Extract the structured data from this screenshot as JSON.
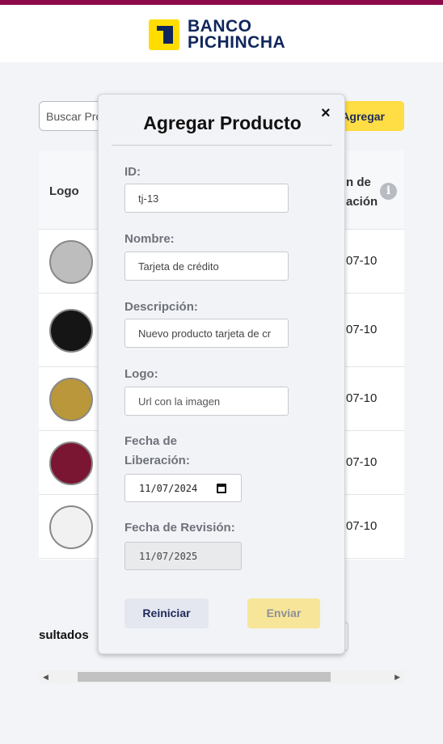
{
  "brand": {
    "line1": "BANCO",
    "line2": "PICHINCHA",
    "primary_color": "#8c0a47",
    "accent_color": "#ffdd00",
    "navy": "#0f265c"
  },
  "toolbar": {
    "search_placeholder": "Buscar Productos...",
    "search_visible": "Buscar Pro",
    "add_label": "Agregar"
  },
  "table": {
    "columns": {
      "logo": "Logo",
      "fecha_line1": "n de",
      "fecha_line2": "ación"
    },
    "rows": [
      {
        "date": "07-10",
        "card_color": "#bdbdbd"
      },
      {
        "date": "07-10",
        "card_color": "#151515"
      },
      {
        "date": "07-10",
        "card_color": "#b9973a"
      },
      {
        "date": "07-10",
        "card_color": "#7a1532"
      },
      {
        "date": "07-10",
        "card_color": "#f1f1f1"
      }
    ]
  },
  "footer": {
    "resultados": "sultados"
  },
  "modal": {
    "title": "Agregar Producto",
    "close": "×",
    "fields": {
      "id_label": "ID:",
      "id_value": "tj-13",
      "nombre_label": "Nombre:",
      "nombre_value": "Tarjeta de crédito",
      "descripcion_label": "Descripción:",
      "descripcion_value": "Nuevo producto tarjeta de cr",
      "logo_label": "Logo:",
      "logo_placeholder": "Url con la imagen",
      "liberacion_label_1": "Fecha de",
      "liberacion_label_2": "Liberación:",
      "liberacion_value": "11/07/2024",
      "revision_label": "Fecha de Revisión:",
      "revision_value": "11/07/2025"
    },
    "reset_label": "Reiniciar",
    "submit_label": "Enviar"
  }
}
